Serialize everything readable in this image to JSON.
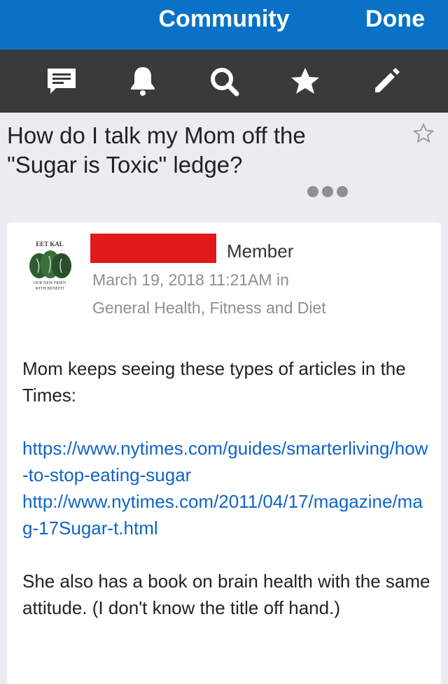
{
  "nav": {
    "title": "Community",
    "done_label": "Done"
  },
  "toolbar": {
    "items": [
      {
        "icon": "chat-icon"
      },
      {
        "icon": "bell-icon"
      },
      {
        "icon": "search-icon"
      },
      {
        "icon": "star-icon"
      },
      {
        "icon": "pencil-icon"
      }
    ]
  },
  "thread": {
    "title": "How do I talk my Mom off the \"Sugar is Toxic\" ledge?"
  },
  "post": {
    "avatar_text_top": "EET KAL",
    "avatar_text_bottom": "OUR NEW FRIEN WITH BENEFIT",
    "role": "Member",
    "date": "March 19, 2018 11:21AM",
    "in_word": "in",
    "category": "General Health, Fitness and Diet",
    "intro": "Mom keeps seeing these types of articles in the Times:",
    "link1": "https://www.nytimes.com/guides/smarterliving/how-to-stop-eating-sugar",
    "link2": "http://www.nytimes.com/2011/04/17/magazine/mag-17Sugar-t.html",
    "closing": "She also has a book on brain health with the same attitude. (I don't know the title off hand.)"
  },
  "colors": {
    "nav": "#0a72c6",
    "toolbar": "#3a3a3a",
    "link": "#1064c6",
    "redaction": "#e0191a"
  }
}
